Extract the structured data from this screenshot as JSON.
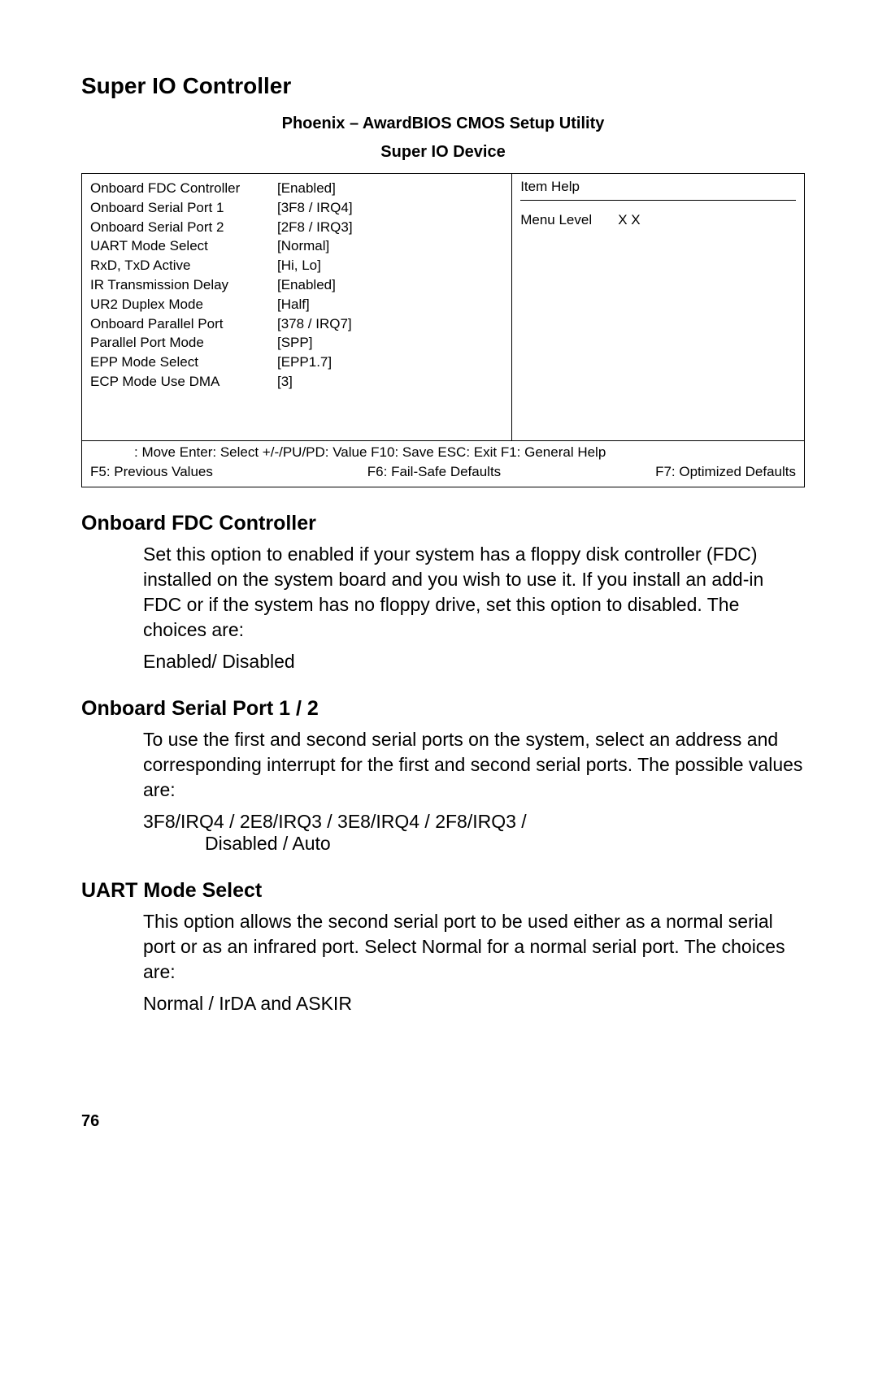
{
  "section_title": "Super IO Controller",
  "bios": {
    "title": "Phoenix – AwardBIOS CMOS Setup Utility",
    "subtitle": "Super IO Device",
    "rows": [
      {
        "label": "Onboard FDC Controller",
        "value": "[Enabled]"
      },
      {
        "label": "Onboard Serial Port 1",
        "value": "[3F8 / IRQ4]"
      },
      {
        "label": "Onboard Serial Port 2",
        "value": "[2F8 / IRQ3]"
      },
      {
        "label": "UART Mode Select",
        "value": "[Normal]"
      },
      {
        "label": "RxD, TxD Active",
        "value": "[Hi, Lo]"
      },
      {
        "label": "IR Transmission Delay",
        "value": "[Enabled]"
      },
      {
        "label": "UR2 Duplex Mode",
        "value": "[Half]"
      },
      {
        "label": "Onboard Parallel Port",
        "value": "[378 / IRQ7]"
      },
      {
        "label": "Parallel Port Mode",
        "value": "[SPP]"
      },
      {
        "label": "EPP Mode Select",
        "value": "[EPP1.7]"
      },
      {
        "label": "ECP Mode Use DMA",
        "value": "[3]"
      }
    ],
    "help": {
      "title": "Item Help",
      "menu_level_label": "Menu Level",
      "menu_level_value": "X X"
    },
    "nav": {
      "line1": ": Move  Enter: Select  +/-/PU/PD: Value  F10: Save  ESC: Exit  F1: General Help",
      "f5": "F5: Previous Values",
      "f6": "F6: Fail-Safe Defaults",
      "f7": "F7: Optimized Defaults"
    }
  },
  "sections": [
    {
      "heading": "Onboard FDC Controller",
      "body": "Set this option to enabled if your system has a floppy disk controller (FDC) installed on the system board and you wish to use it. If you install an add-in FDC or if the system has no floppy drive, set this option to disabled. The choices are:",
      "choice": "Enabled/ Disabled"
    },
    {
      "heading": "Onboard Serial Port 1 / 2",
      "body": "To use the first and second serial ports on the system, select an address and corresponding interrupt for the first and second serial ports. The possible values are:",
      "choice": "3F8/IRQ4 / 2E8/IRQ3 / 3E8/IRQ4 / 2F8/IRQ3 /",
      "choice_line2": "Disabled / Auto"
    },
    {
      "heading": "UART Mode Select",
      "body": "This option allows the second serial port to be used either as a normal serial port or as an infrared port. Select Normal for a normal serial port. The choices are:",
      "choice": "Normal / IrDA and ASKIR"
    }
  ],
  "page_number": "76"
}
